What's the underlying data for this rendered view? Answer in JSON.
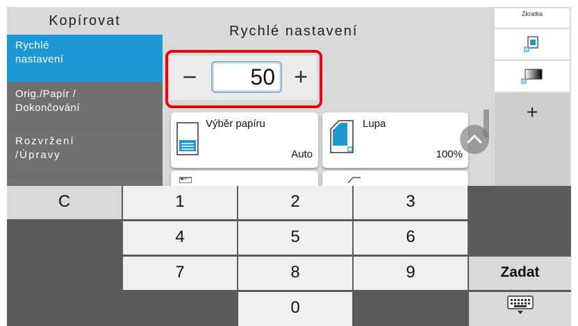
{
  "sidebar": {
    "title": "Kopírovat",
    "items": [
      {
        "line1": "Rychlé",
        "line2": "nastavení"
      },
      {
        "line1": "Orig./Papír /",
        "line2": "Dokončování"
      },
      {
        "line1": "Rozvržení",
        "line2": "/Úpravy"
      }
    ]
  },
  "main": {
    "title": "Rychlé nastavení",
    "copies": {
      "minus": "−",
      "value": "50",
      "plus": "+"
    },
    "tiles": [
      {
        "label": "Výběr papíru",
        "value": "Auto",
        "icon": "paper-tray-icon"
      },
      {
        "label": "Lupa",
        "value": "100%",
        "icon": "zoom-icon"
      }
    ]
  },
  "shortcuts": {
    "title": "Zkratka",
    "add_label": "+"
  },
  "keypad": {
    "clear": "C",
    "digits": [
      "1",
      "2",
      "3",
      "4",
      "5",
      "6",
      "7",
      "8",
      "9",
      "0"
    ],
    "enter": "Zadat",
    "keyboard_icon": "keyboard-icon"
  },
  "colors": {
    "accent": "#1e98d3",
    "highlight": "#e3000f"
  }
}
